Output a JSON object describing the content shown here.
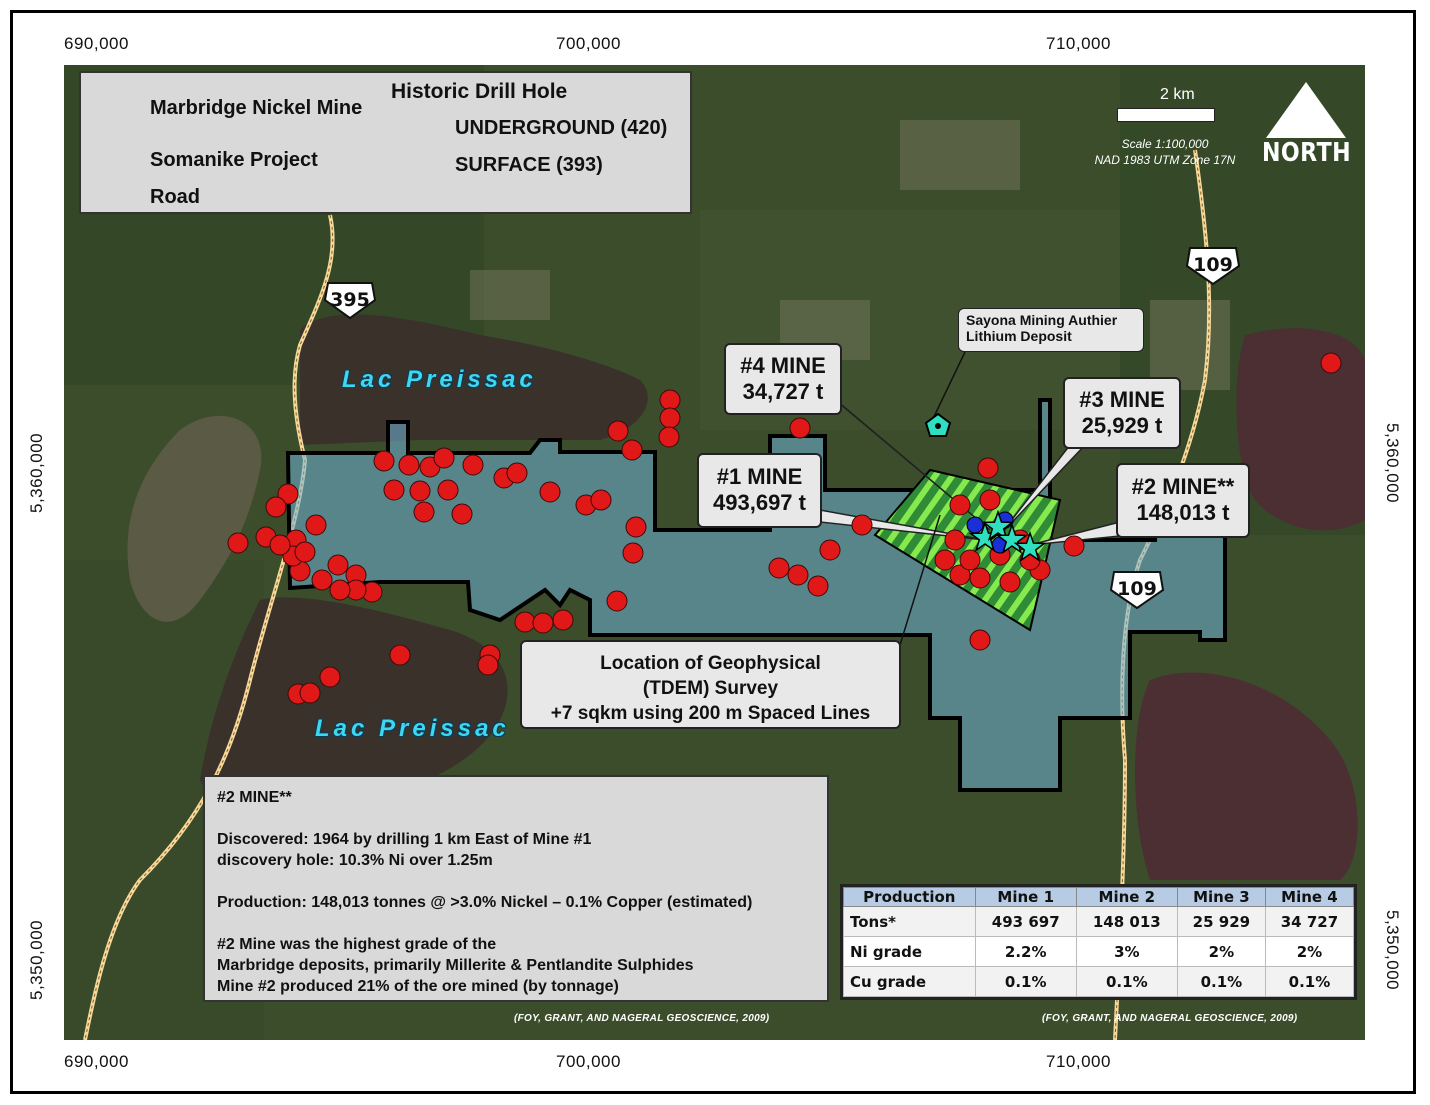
{
  "grid_labels": {
    "top": [
      "690,000",
      "700,000",
      "710,000"
    ],
    "bottom": [
      "690,000",
      "700,000",
      "710,000"
    ],
    "left": [
      "5,360,000",
      "5,350,000"
    ],
    "right": [
      "5,360,000",
      "5,350,000"
    ]
  },
  "legend": {
    "mine_label": "Marbridge Nickel Mine",
    "project_label": "Somanike Project",
    "road_label": "Road",
    "drill_header": "Historic Drill Hole",
    "underground_label": "UNDERGROUND (420)",
    "surface_label": "SURFACE (393)"
  },
  "scale": {
    "bar_label": "2 km",
    "line1": "Scale 1:100,000",
    "line2": "NAD 1983 UTM Zone 17N",
    "north": "NORTH"
  },
  "lakes": [
    "Lac Preissac",
    "Lac Preissac"
  ],
  "highways": [
    "395",
    "109",
    "109"
  ],
  "callouts": {
    "mine4": {
      "name": "#4 MINE",
      "tons": "34,727 t"
    },
    "mine3": {
      "name": "#3 MINE",
      "tons": "25,929 t"
    },
    "mine1": {
      "name": "#1 MINE",
      "tons": "493,697 t"
    },
    "mine2": {
      "name": "#2 MINE**",
      "tons": "148,013 t"
    },
    "sayona": {
      "line1": "Sayona Mining Authier",
      "line2": "Lithium Deposit"
    },
    "survey": {
      "line1": "Location of Geophysical",
      "line2": "(TDEM) Survey",
      "line3": "+7 sqkm using 200 m Spaced Lines"
    }
  },
  "info_box": {
    "title": "#2 MINE**",
    "discovered": "Discovered: 1964 by drilling 1 km East of Mine #1",
    "discovery_hole": "discovery hole: 10.3% Ni over 1.25m",
    "production": "Production: 148,013 tonnes @ >3.0% Nickel – 0.1% Copper (estimated)",
    "note1": "#2 Mine was the highest grade of the",
    "note2": "Marbridge deposits, primarily Millerite & Pentlandite Sulphides",
    "note3": "Mine #2 produced 21% of the ore mined (by tonnage)"
  },
  "production_table": {
    "headers": [
      "Production",
      "Mine 1",
      "Mine 2",
      "Mine 3",
      "Mine 4"
    ],
    "rows": [
      [
        "Tons*",
        "493 697",
        "148 013",
        "25 929",
        "34 727"
      ],
      [
        "Ni grade",
        "2.2%",
        "3%",
        "2%",
        "2%"
      ],
      [
        "Cu grade",
        "0.1%",
        "0.1%",
        "0.1%",
        "0.1%"
      ]
    ]
  },
  "sources": [
    "(FOY, GRANT, AND NAGERAL GEOSCIENCE, 2009)",
    "(FOY, GRANT, AND NAGERAL GEOSCIENCE, 2009)"
  ],
  "colors": {
    "mine_star": "#2fe0c0",
    "project_fill": "#6fb5d8",
    "underground": "#1a2fd6",
    "surface": "#e01818",
    "road": "#f5d89a",
    "survey_grid": "#7be34a"
  }
}
